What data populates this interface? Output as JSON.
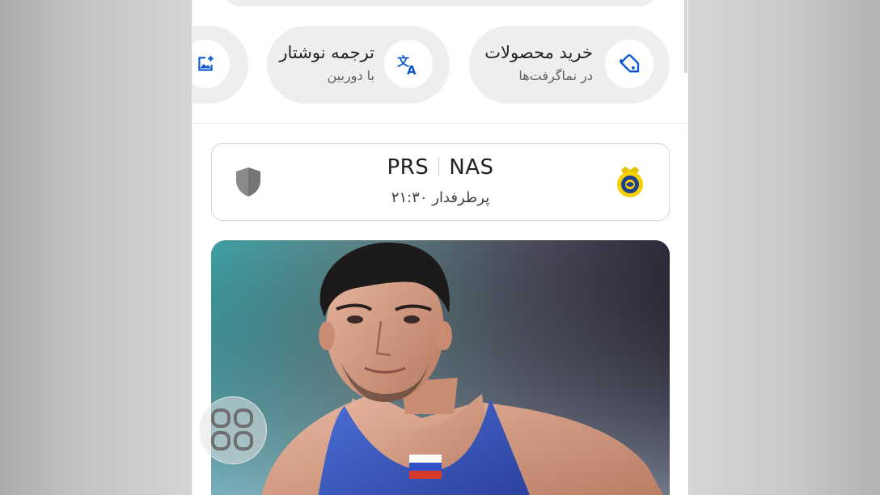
{
  "lens_actions": [
    {
      "title": "خرید محصولات",
      "subtitle": "در نماگرفت‌ها",
      "icon": "tag-icon"
    },
    {
      "title": "ترجمه نوشتار",
      "subtitle": "با دوربین",
      "icon": "translate-icon"
    },
    {
      "title": "",
      "subtitle": "",
      "icon": "image-add-icon"
    }
  ],
  "match": {
    "home_team": "PRS",
    "away_team": "NAS",
    "status": "پرطرفدار ۲۱:۳۰"
  },
  "colors": {
    "accent": "#0b57d0",
    "chip_bg": "#eeeeee",
    "crest_yellow": "#f4d000",
    "crest_blue": "#1d3f8f"
  },
  "floating_button": {
    "icon": "app-grid-icon"
  }
}
